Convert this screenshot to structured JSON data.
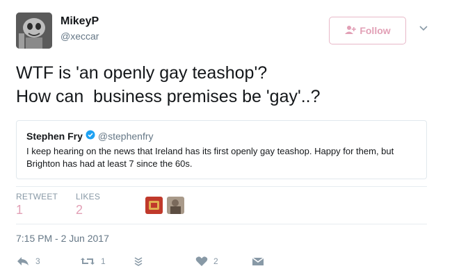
{
  "author": {
    "display_name": "MikeyP",
    "handle": "@xeccar"
  },
  "follow_button": {
    "label": "Follow"
  },
  "tweet": {
    "line1": "WTF is 'an openly gay teashop'?",
    "line2": "How can  business premises be 'gay'..?"
  },
  "quoted_tweet": {
    "display_name": "Stephen Fry",
    "handle": "@stephenfry",
    "verified": true,
    "text": "I keep hearing on the news that Ireland has its first openly gay teashop. Happy for them, but Brighton has had at least 7 since the 60s."
  },
  "stats": {
    "retweets_label": "RETWEET",
    "retweets_value": "1",
    "likes_label": "LIKES",
    "likes_value": "2"
  },
  "timestamp": "7:15 PM - 2 Jun 2017",
  "actions": {
    "reply_count": "3",
    "retweet_count": "1",
    "like_count": "2"
  },
  "colors": {
    "accent_pink": "#e2a0b6",
    "verified_blue": "#1da1f2",
    "muted": "#8899a6"
  }
}
